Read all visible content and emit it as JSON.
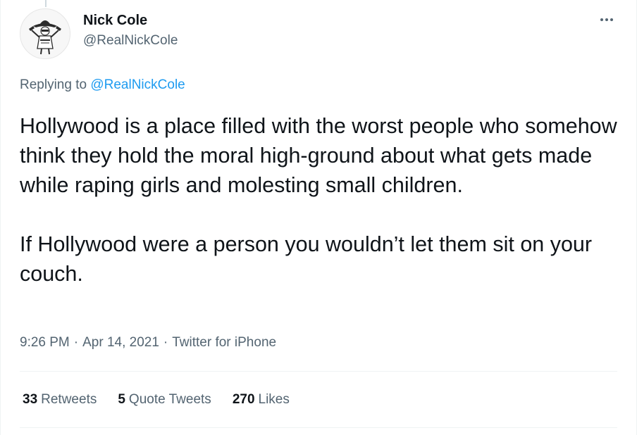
{
  "author": {
    "display_name": "Nick Cole",
    "handle": "@RealNickCole",
    "avatar_icon": "cowboy-gunslinger-avatar"
  },
  "reply_context": {
    "prefix": "Replying to ",
    "target_handle": "@RealNickCole"
  },
  "tweet": {
    "text": "Hollywood is a place filled with the worst people who somehow think they hold the moral high-ground about what gets made while raping girls and molesting small children.\n\nIf Hollywood were a person you wouldn’t let them sit on your couch."
  },
  "meta": {
    "time": "9:26 PM",
    "date": "Apr 14, 2021",
    "separator": "·",
    "source": "Twitter for iPhone"
  },
  "stats": {
    "retweets_count": "33",
    "retweets_label": "Retweets",
    "quotes_count": "5",
    "quotes_label": "Quote Tweets",
    "likes_count": "270",
    "likes_label": "Likes"
  },
  "colors": {
    "link": "#1d9bf0",
    "secondary_text": "#536471",
    "primary_text": "#0f1419",
    "divider": "#eff3f4"
  }
}
